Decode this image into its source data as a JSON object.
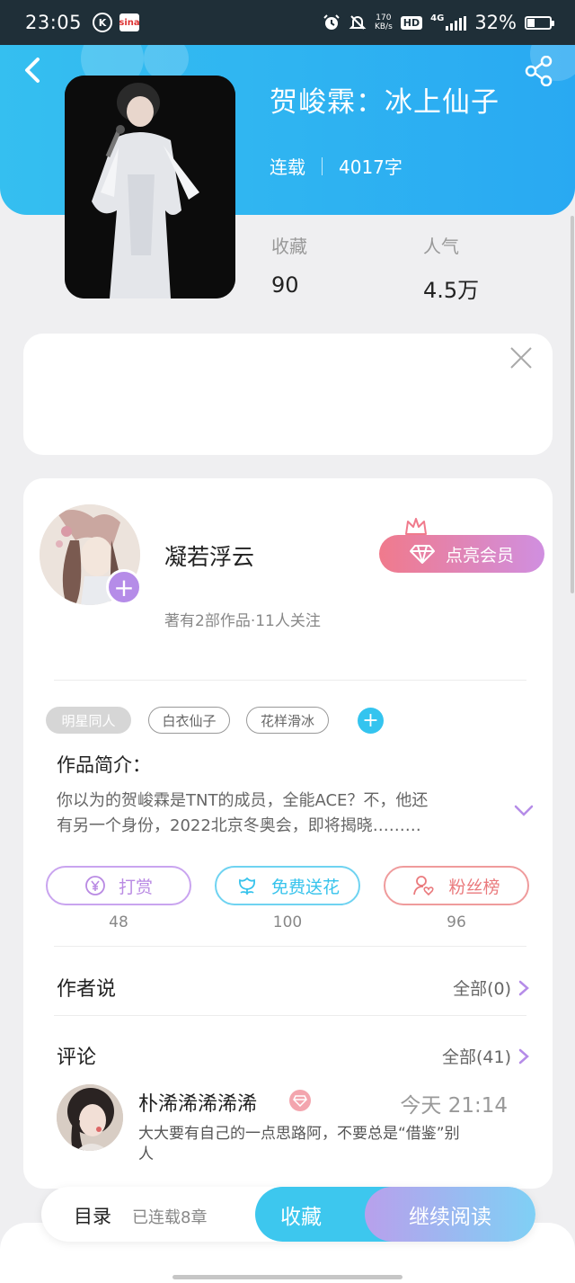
{
  "status_bar": {
    "time": "23:05",
    "net_speed_value": "170",
    "net_speed_unit": "KB/s",
    "hd": "HD",
    "network": "4G",
    "battery": "32%"
  },
  "book": {
    "title": "贺峻霖：冰上仙子",
    "status": "连载",
    "word_count": "4017字",
    "favorites_label": "收藏",
    "favorites_value": "90",
    "popularity_label": "人气",
    "popularity_value": "4.5万"
  },
  "author": {
    "name": "凝若浮云",
    "info": "著有2部作品·11人关注",
    "vip_button": "点亮会员"
  },
  "tags": [
    "明星同人",
    "白衣仙子",
    "花样滑冰"
  ],
  "intro": {
    "title": "作品简介：",
    "line1": "你以为的贺峻霖是TNT的成员，全能ACE？不，他还",
    "line2": "有另一个身份，2022北京冬奥会，即将揭晓………"
  },
  "actions": [
    {
      "label": "打赏",
      "count": "48",
      "color": "#b98ae3"
    },
    {
      "label": "免费送花",
      "count": "100",
      "color": "#36c3ec"
    },
    {
      "label": "粉丝榜",
      "count": "96",
      "color": "#ea7a7d"
    }
  ],
  "author_says": {
    "title": "作者说",
    "link": "全部(0)"
  },
  "comments": {
    "title": "评论",
    "link": "全部(41)",
    "item": {
      "name": "朴浠浠浠浠浠",
      "time": "今天 21:14",
      "line1": "大大要有自己的一点思路阿，不要总是“借鉴”别",
      "line2": "人"
    }
  },
  "bottom_bar": {
    "toc": "目录",
    "toc_sub": "已连载8章",
    "favorite": "收藏",
    "continue": "继续阅读"
  },
  "colors": {
    "header": "#2fb4f1",
    "vip_gradient_start": "#f07a8c",
    "vip_gradient_end": "#d08fe0",
    "accent_purple": "#b58ce8",
    "accent_blue": "#36c3ec"
  }
}
